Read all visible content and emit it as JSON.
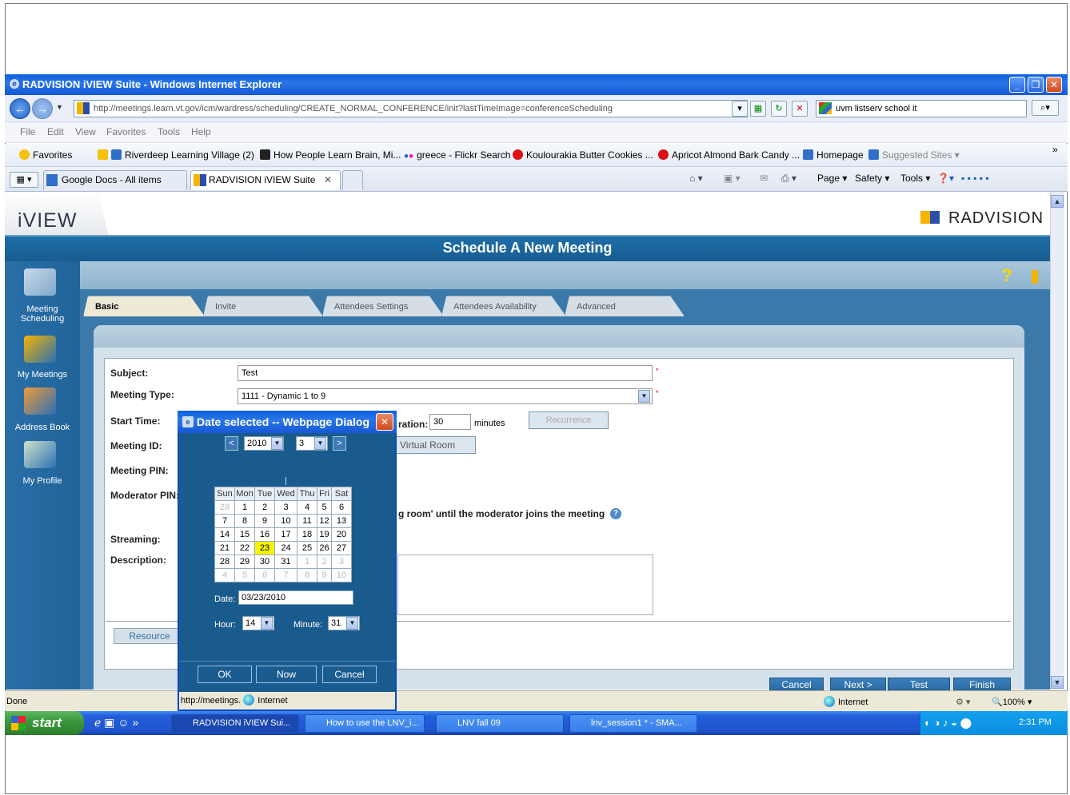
{
  "browser": {
    "title": "RADVISION iVIEW Suite - Windows Internet Explorer",
    "url": "http://meetings.learn.vt.gov/icm/wardress/scheduling/CREATE_NORMAL_CONFERENCE/init?lastTimeImage=conferenceScheduling",
    "search": "uvm listserv school it",
    "menu": [
      "File",
      "Edit",
      "View",
      "Favorites",
      "Tools",
      "Help"
    ],
    "favorites_label": "Favorites",
    "favorites": [
      "Riverdeep Learning Village (2)",
      "How People Learn Brain, Mi...",
      "greece - Flickr Search",
      "Koulourakia Butter Cookies ...",
      "Apricot Almond Bark Candy ...",
      "Homepage",
      "Suggested Sites ▾"
    ],
    "tabs": [
      "Google Docs - All items",
      "RADVISION iVIEW Suite"
    ],
    "commands": [
      "Page ▾",
      "Safety ▾",
      "Tools ▾"
    ],
    "status": "Done",
    "zone": "Internet",
    "zoom": "100%"
  },
  "app": {
    "logo": "iVIEW",
    "brand": "RADVISION",
    "header_title": "Schedule A New Meeting",
    "sidebar": [
      "Meeting Scheduling",
      "My Meetings",
      "Address Book",
      "My Profile"
    ],
    "tabs": [
      "Basic",
      "Invite",
      "Attendees Settings",
      "Attendees Availability",
      "Advanced"
    ],
    "form": {
      "subject_label": "Subject:",
      "subject_value": "Test",
      "meeting_type_label": "Meeting Type:",
      "meeting_type_value": "1111 - Dynamic 1 to 9",
      "start_time_label": "Start Time:",
      "duration_label": "ration:",
      "duration_value": "30",
      "minutes_label": "minutes",
      "recurrence_button": "Recurrence",
      "meeting_id_label": "Meeting ID:",
      "virtual_room_button": "Virtual Room",
      "meeting_pin_label": "Meeting PIN:",
      "moderator_pin_label": "Moderator PIN:",
      "waiting_text": "g room' until the moderator joins the meeting",
      "streaming_label": "Streaming:",
      "description_label": "Description:",
      "resources_button": "Resource"
    },
    "footer_buttons": [
      "Cancel",
      "Next >",
      "Test",
      "Finish"
    ]
  },
  "dialog": {
    "title": "Date selected -- Webpage Dialog",
    "year": "2010",
    "month": "3",
    "prev": "<",
    "next": ">",
    "weekdays": [
      "Sun",
      "Mon",
      "Tue",
      "Wed",
      "Thu",
      "Fri",
      "Sat"
    ],
    "weeks": [
      [
        "28",
        "1",
        "2",
        "3",
        "4",
        "5",
        "6"
      ],
      [
        "7",
        "8",
        "9",
        "10",
        "11",
        "12",
        "13"
      ],
      [
        "14",
        "15",
        "16",
        "17",
        "18",
        "19",
        "20"
      ],
      [
        "21",
        "22",
        "23",
        "24",
        "25",
        "26",
        "27"
      ],
      [
        "28",
        "29",
        "30",
        "31",
        "1",
        "2",
        "3"
      ],
      [
        "4",
        "5",
        "6",
        "7",
        "8",
        "9",
        "10"
      ]
    ],
    "date_label": "Date:",
    "date_value": "03/23/2010",
    "hour_label": "Hour:",
    "hour_value": "14",
    "minute_label": "Minute:",
    "minute_value": "31",
    "ok": "OK",
    "now": "Now",
    "cancel": "Cancel",
    "status_url": "http://meetings.",
    "status_zone": "Internet"
  },
  "taskbar": {
    "start": "start",
    "items": [
      "RADVISION iVIEW Sui...",
      "How to use the LNV_i...",
      "LNV fall 09",
      "lnv_session1 * - SMA..."
    ],
    "clock": "2:31 PM"
  }
}
